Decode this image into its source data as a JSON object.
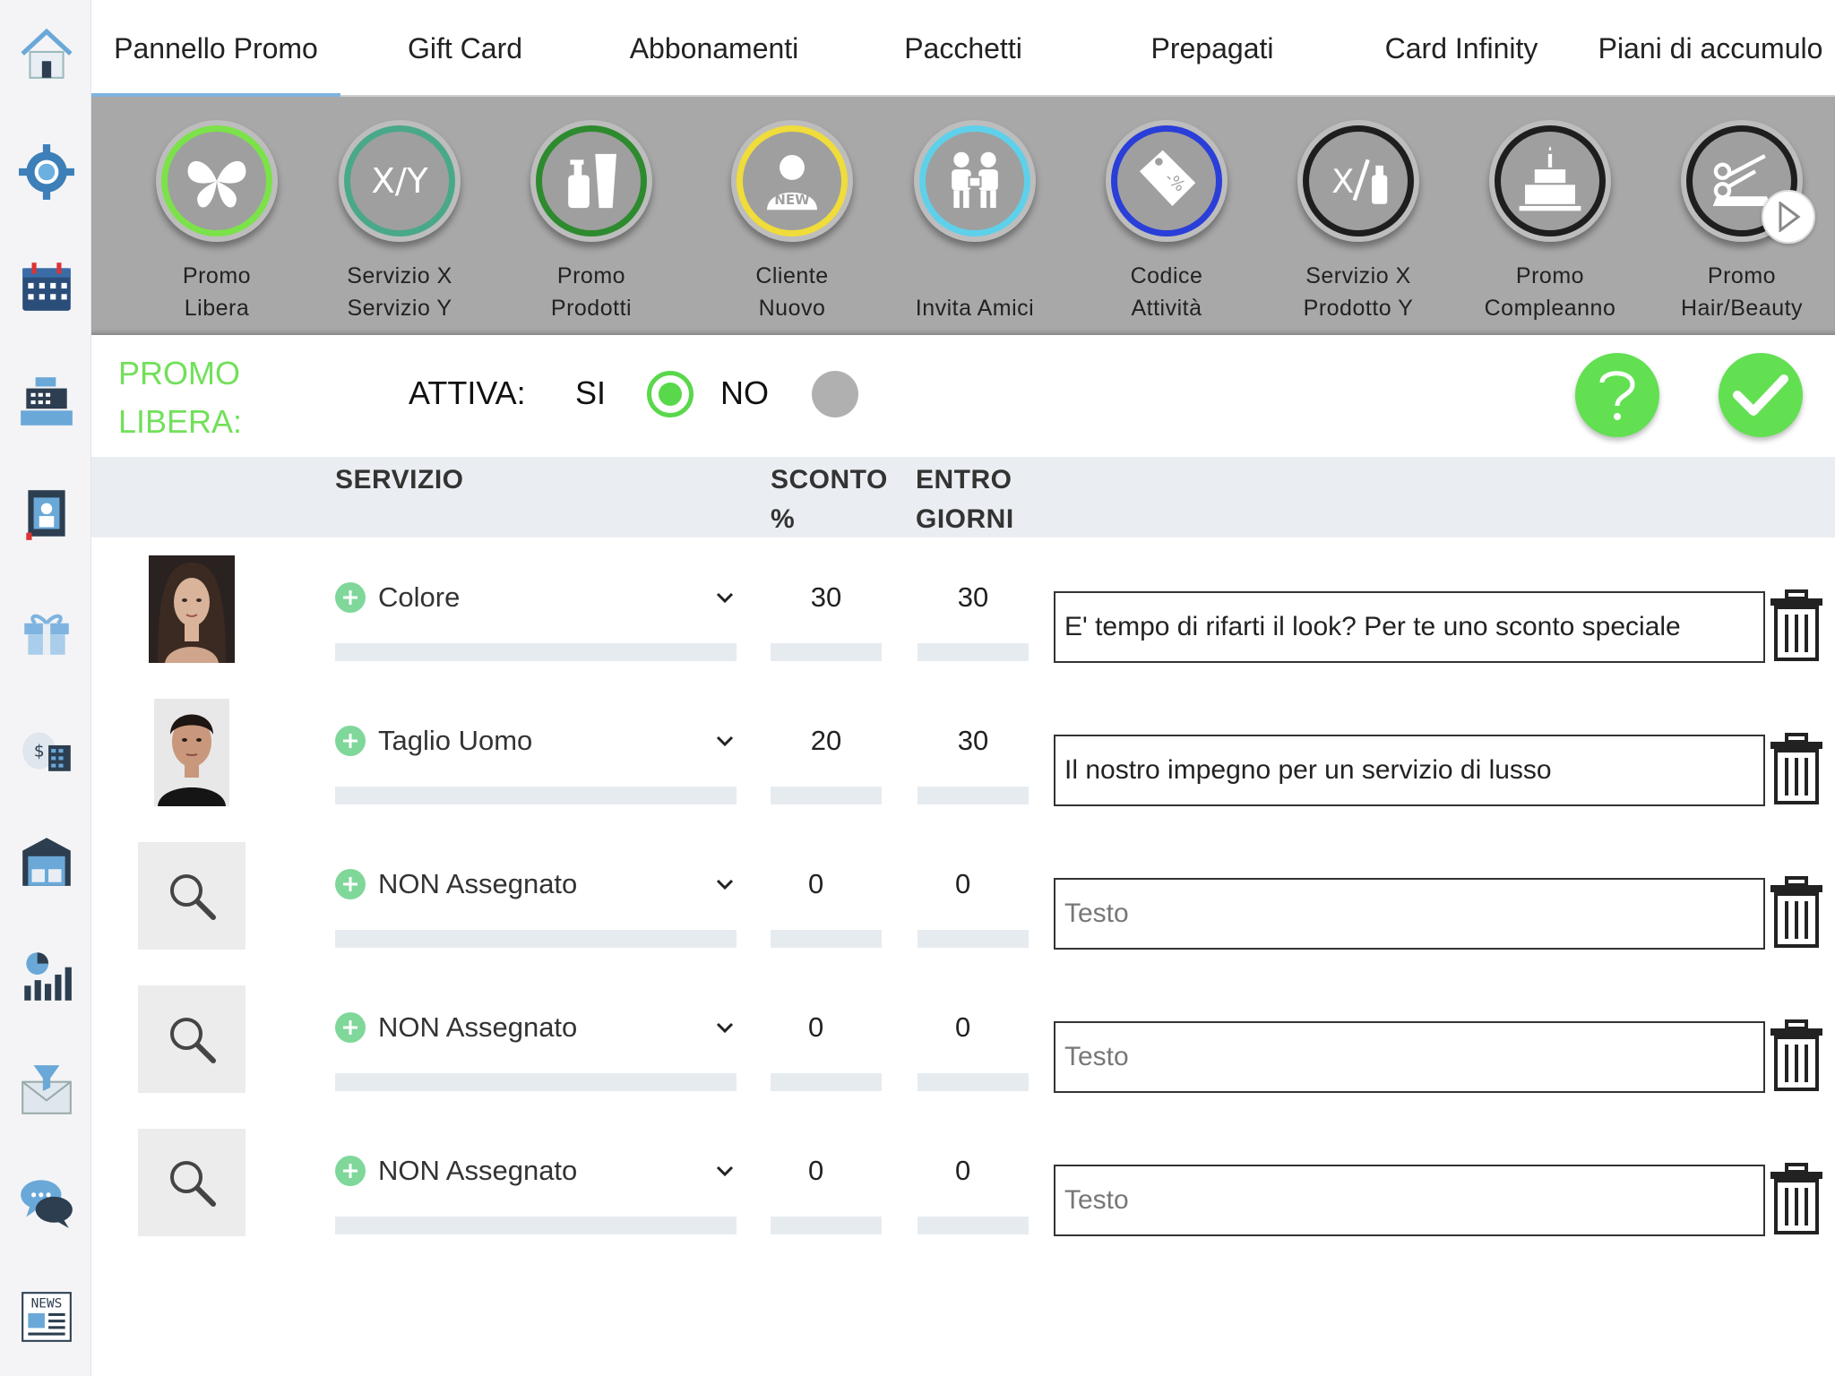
{
  "tabs": [
    {
      "label": "Pannello Promo",
      "active": true
    },
    {
      "label": "Gift Card"
    },
    {
      "label": "Abbonamenti"
    },
    {
      "label": "Pacchetti"
    },
    {
      "label": "Prepagati"
    },
    {
      "label": "Card Infinity"
    },
    {
      "label": "Piani di accumulo"
    }
  ],
  "sidebar": {
    "items": [
      "home-icon",
      "gear-icon",
      "calendar-icon",
      "cash-register-icon",
      "card-icon",
      "gift-icon",
      "money-calculator-icon",
      "warehouse-icon",
      "analytics-chart-icon",
      "email-funnel-icon",
      "chat-icon",
      "news-icon"
    ]
  },
  "promos": [
    {
      "line1": "Promo",
      "line2": "Libera",
      "ring_color": "#7be24a",
      "icon": "butterfly-icon"
    },
    {
      "line1": "Servizio X",
      "line2": "Servizio Y",
      "ring_color": "#4aa88a",
      "icon": "x-slash-y-icon"
    },
    {
      "line1": "Promo",
      "line2": "Prodotti",
      "ring_color": "#2e8a2e",
      "icon": "products-icon"
    },
    {
      "line1": "Cliente",
      "line2": "Nuovo",
      "ring_color": "#f0dc3a",
      "icon": "new-client-icon"
    },
    {
      "line1": "",
      "line2": "Invita Amici",
      "ring_color": "#5fd0ea",
      "icon": "invite-friends-icon"
    },
    {
      "line1": "Codice",
      "line2": "Attività",
      "ring_color": "#2a3ed8",
      "icon": "coupon-tag-icon"
    },
    {
      "line1": "Servizio X",
      "line2": "Prodotto Y",
      "ring_color": "#1e1e1e",
      "icon": "service-product-icon"
    },
    {
      "line1": "Promo",
      "line2": "Compleanno",
      "ring_color": "#1e1e1e",
      "icon": "birthday-cake-icon"
    },
    {
      "line1": "Promo",
      "line2": "Hair/Beauty",
      "ring_color": "#1e1e1e",
      "icon": "scissors-icon"
    }
  ],
  "header": {
    "title_line1": "PROMO",
    "title_line2": "LIBERA:",
    "attiva_label": "ATTIVA:",
    "si_label": "SI",
    "no_label": "NO"
  },
  "table": {
    "col_servizio": "SERVIZIO",
    "col_sconto_line1": "SCONTO",
    "col_sconto_line2": "%",
    "col_giorni_line1": "ENTRO",
    "col_giorni_line2": "GIORNI",
    "rows": [
      {
        "thumb": "woman-photo",
        "service": "Colore",
        "sconto": "30",
        "giorni": "30",
        "text": "E' tempo di rifarti il look? Per te uno sconto speciale",
        "placeholder": "Testo"
      },
      {
        "thumb": "man-photo",
        "service": "Taglio Uomo",
        "sconto": "20",
        "giorni": "30",
        "text": "Il nostro impegno per un servizio di lusso",
        "placeholder": "Testo"
      },
      {
        "thumb": "search",
        "service": "NON Assegnato",
        "sconto": "0",
        "giorni": "0",
        "text": "",
        "placeholder": "Testo"
      },
      {
        "thumb": "search",
        "service": "NON Assegnato",
        "sconto": "0",
        "giorni": "0",
        "text": "",
        "placeholder": "Testo"
      },
      {
        "thumb": "search",
        "service": "NON Assegnato",
        "sconto": "0",
        "giorni": "0",
        "text": "",
        "placeholder": "Testo"
      }
    ]
  },
  "colors": {
    "accent_green": "#62e052",
    "title_green": "#72e05a",
    "tab_underline": "#7fb4e0",
    "strip_gray": "#a8a8a8"
  }
}
